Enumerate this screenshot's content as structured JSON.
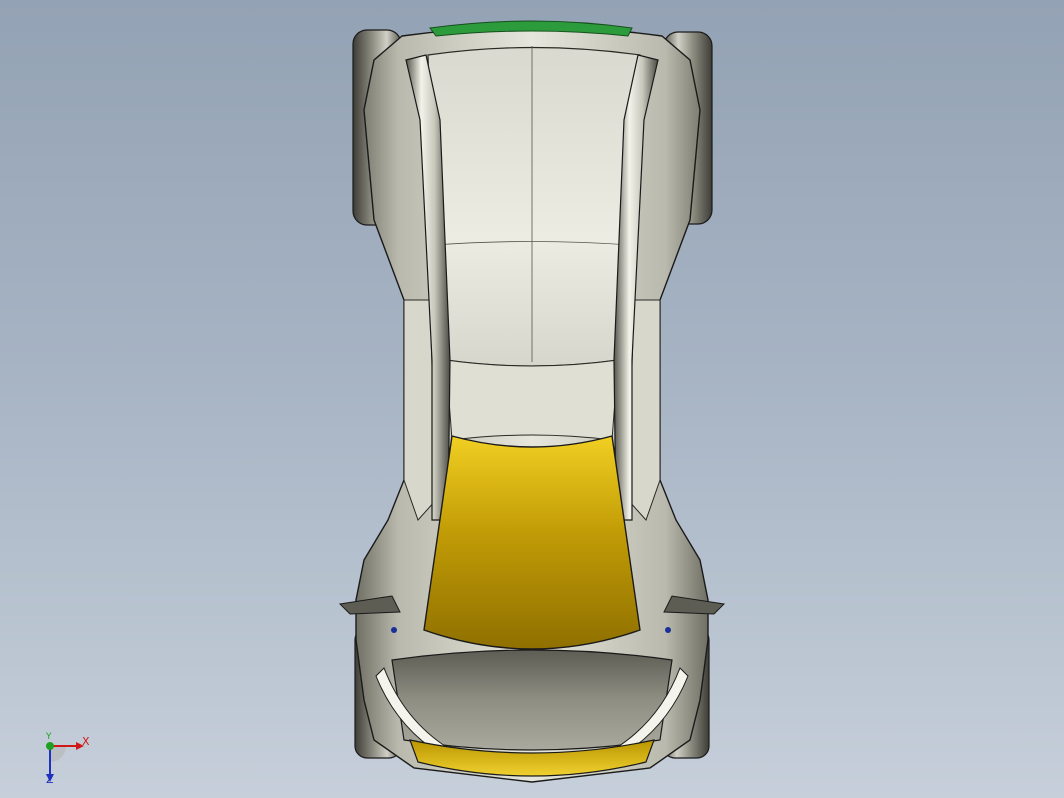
{
  "viewport": {
    "background_top": "#93a2b4",
    "background_bottom": "#c6cfda"
  },
  "model": {
    "description_icon": "car-top-view-model",
    "colors": {
      "body": "#cfcfc4",
      "body_shade": "#77776b",
      "tire": "#5a5a52",
      "edge": "#1a1a1a",
      "windshield_light": "#e8c21e",
      "windshield_dark": "#9a7800",
      "rear_grille": "#2c9b3b",
      "accent_blue": "#1b2f9a"
    }
  },
  "triad": {
    "x_label": "X",
    "y_label": "Y",
    "z_label": "Z",
    "x_color": "#d01818",
    "y_color": "#20a020",
    "z_color": "#2030c0"
  }
}
